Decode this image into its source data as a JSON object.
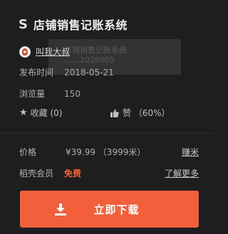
{
  "header": {
    "brand_icon": "S",
    "title": "店铺销售记账系统"
  },
  "tooltip_ghost": {
    "line1": "店铺销售记账系统",
    "line2": "……2028005"
  },
  "author": {
    "name": "叫我大叔",
    "avatar_icon": "user-avatar"
  },
  "meta": {
    "publish_label": "发布时间",
    "publish_value": "2018-05-21",
    "views_label": "浏览量",
    "views_value": "150"
  },
  "stats": {
    "favorite_icon": "star-icon",
    "favorite_text": "收藏 (0)",
    "like_icon": "thumbs-up-icon",
    "like_text": "赞 （60%）"
  },
  "price": {
    "label": "价格",
    "value": "¥39.99 （3999米）",
    "link": "赚米"
  },
  "member": {
    "label": "稻壳会员",
    "value": "免费",
    "link": "了解更多"
  },
  "download": {
    "label": "立即下载",
    "icon": "download-icon"
  },
  "colors": {
    "background": "#1e1e1e",
    "accent": "#f25f3a"
  }
}
